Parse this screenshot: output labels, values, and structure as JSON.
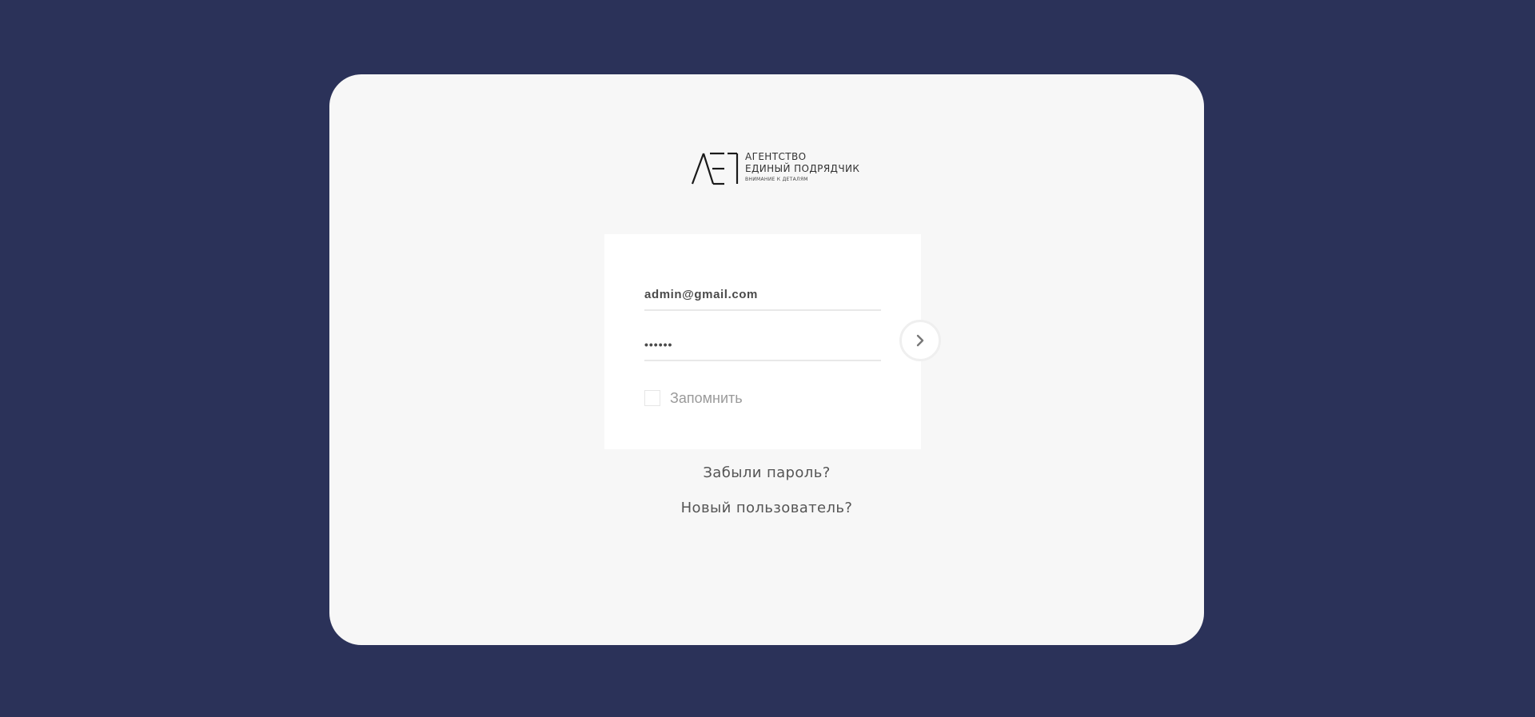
{
  "brand": {
    "mark": "AE1",
    "line1": "АГЕНТСТВО",
    "line2": "ЕДИНЫЙ ПОДРЯДЧИК",
    "tagline": "ВНИМАНИЕ К ДЕТАЛЯМ"
  },
  "login": {
    "email_value": "admin@gmail.com",
    "password_value": "••••••",
    "remember_label": "Запомнить",
    "remember_checked": false,
    "submit_icon": "chevron-right-icon"
  },
  "links": {
    "forgot_password": "Забыли пароль?",
    "new_user": "Новый пользователь?"
  },
  "colors": {
    "background": "#2b3259",
    "card": "#f7f7f7",
    "form": "#ffffff",
    "text": "#555555",
    "muted": "#9a9a9a"
  }
}
